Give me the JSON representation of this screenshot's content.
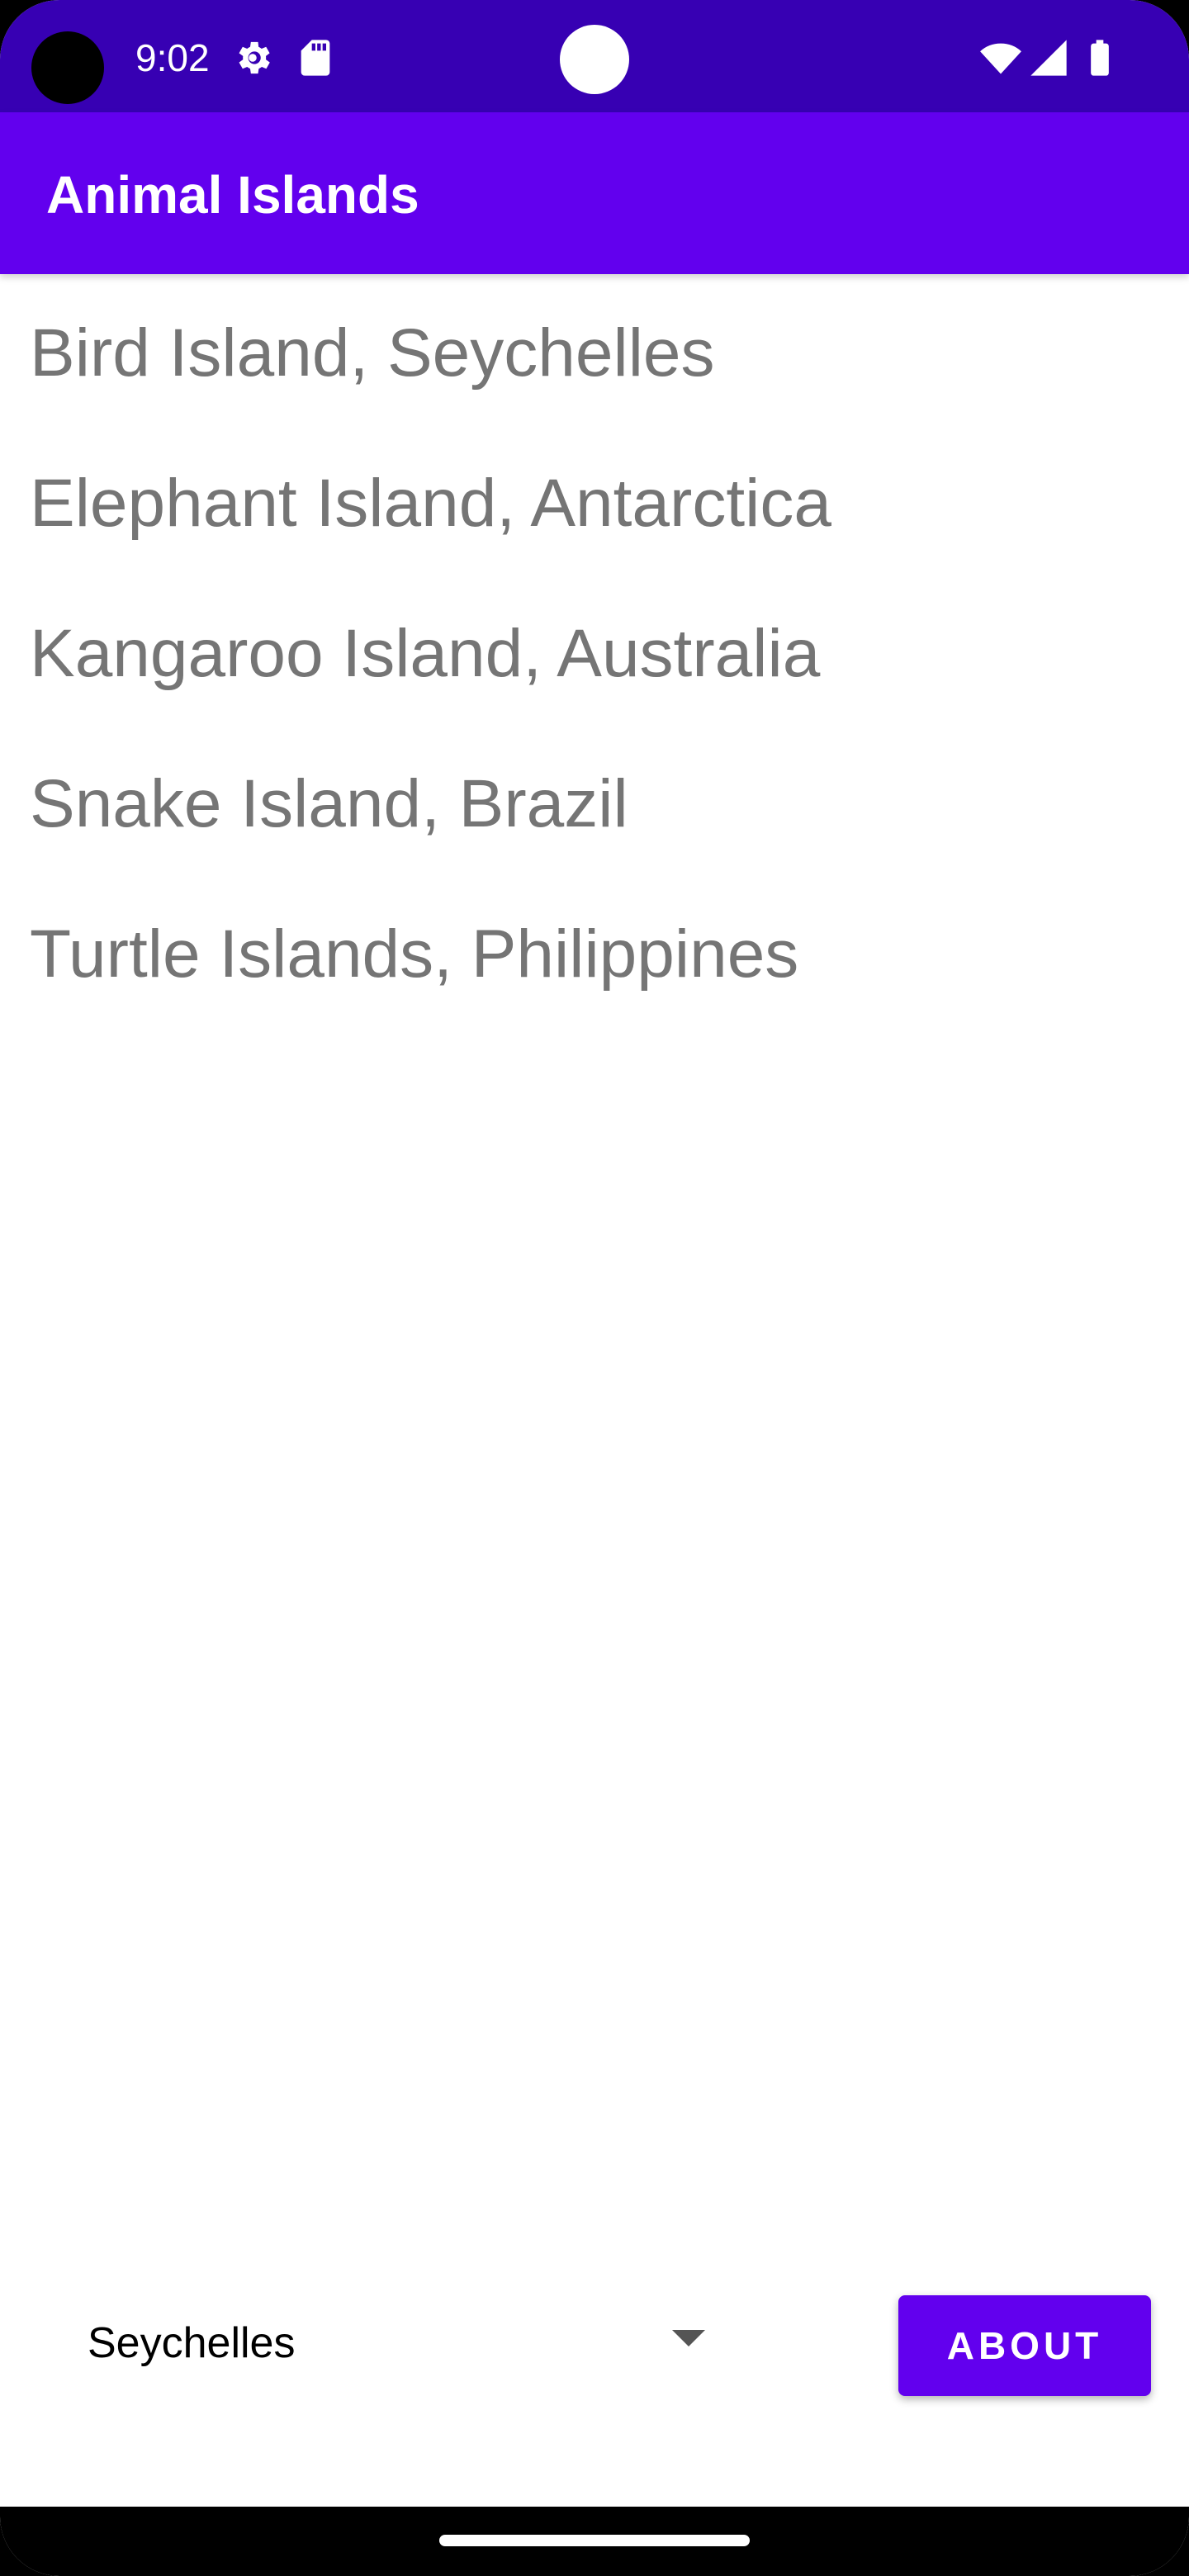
{
  "status_bar": {
    "time": "9:02",
    "icons": [
      "gear-icon",
      "sd-card-icon",
      "wifi-icon",
      "signal-icon",
      "battery-icon"
    ],
    "background_color": "#3700b3"
  },
  "app_bar": {
    "title": "Animal Islands",
    "background_color": "#6200ee"
  },
  "islands": [
    {
      "label": "Bird Island, Seychelles"
    },
    {
      "label": "Elephant Island, Antarctica"
    },
    {
      "label": "Kangaroo Island, Australia"
    },
    {
      "label": "Snake Island, Brazil"
    },
    {
      "label": "Turtle Islands, Philippines"
    }
  ],
  "spinner": {
    "selected": "Seychelles"
  },
  "about_button": {
    "label": "ABOUT"
  }
}
